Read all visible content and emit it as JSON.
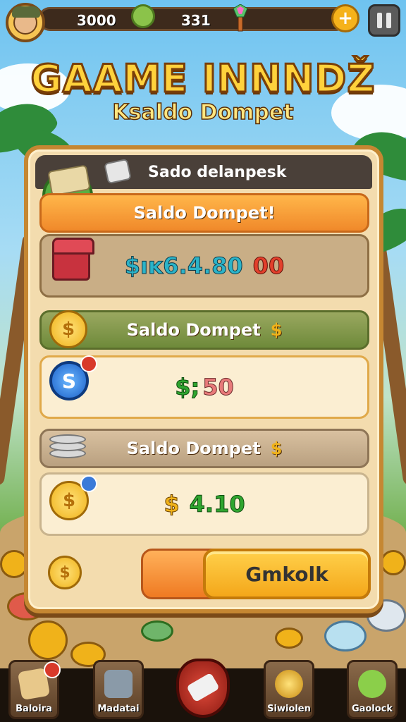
{
  "topbar": {
    "coins_value": "3000",
    "gems_value": "331",
    "plus_label": "+",
    "pause_label": "pause"
  },
  "title": {
    "main": "GAAME INNNDŽ",
    "sub": "Ksaldo Dompet"
  },
  "panel": {
    "header": "Sado delanpesk",
    "rows": [
      {
        "banner": "Saldo Dompet!",
        "value_main": "$ıĸ6.4.80",
        "value_extra": "00",
        "value_main_color": "#2bb3c8",
        "value_extra_color": "#e2402c"
      },
      {
        "banner": "Saldo Dompet",
        "banner_icon": "$",
        "value_main": "$;",
        "value_extra": "50",
        "value_main_color": "#2fa52f",
        "value_extra_color": "#e87a7a"
      },
      {
        "banner": "Saldo Dompet",
        "banner_icon": "$",
        "value_main": "$",
        "value_extra": "4.10",
        "value_main_color": "#f0b21a",
        "value_extra_color": "#2fa52f"
      }
    ],
    "action_button": "Gmkolk"
  },
  "bottom_nav": [
    {
      "label": "Baloira",
      "icon": "map-icon"
    },
    {
      "label": "Madatai",
      "icon": "backpack-icon"
    },
    {
      "label": "",
      "icon": "shield-icon"
    },
    {
      "label": "Siwiolen",
      "icon": "coin-icon"
    },
    {
      "label": "Gaolock",
      "icon": "character-icon"
    }
  ],
  "colors": {
    "title_yellow": "#ffd23c",
    "panel_bg": "#f3dcae",
    "orange_banner": "#f0892a",
    "green_banner": "#6e8a3a",
    "button_yellow": "#f4a71a"
  }
}
